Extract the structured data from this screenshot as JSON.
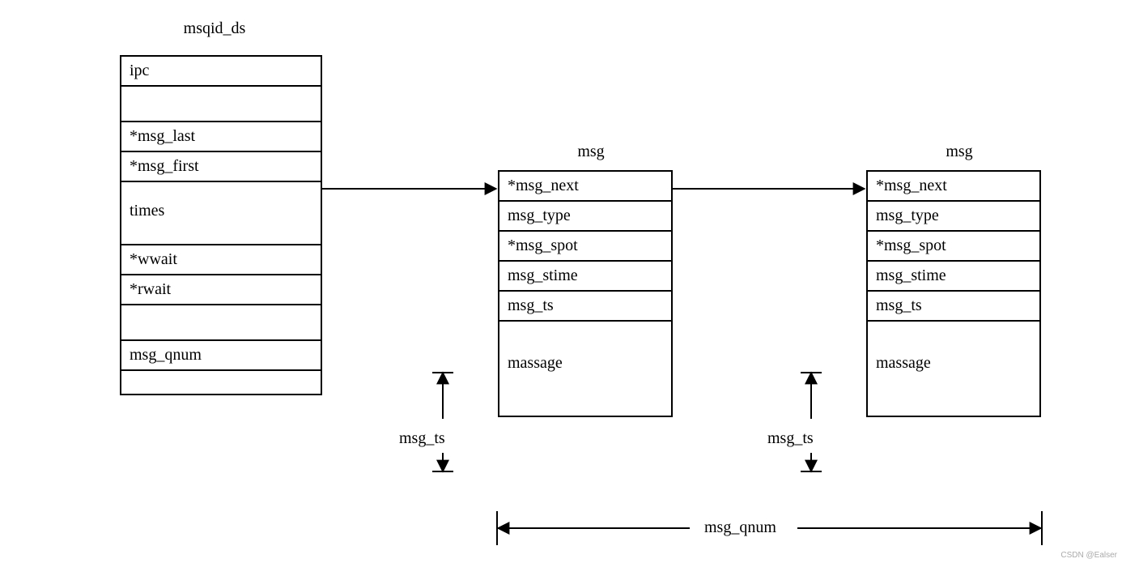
{
  "msqid_ds": {
    "title": "msqid_ds",
    "rows": [
      "ipc",
      "",
      "*msg_last",
      "*msg_first",
      "times",
      "*wwait",
      "*rwait",
      "",
      "msg_qnum",
      ""
    ]
  },
  "msg1": {
    "title": "msg",
    "rows": [
      "*msg_next",
      "msg_type",
      "*msg_spot",
      "msg_stime",
      "msg_ts",
      "massage"
    ]
  },
  "msg2": {
    "title": "msg",
    "rows": [
      "*msg_next",
      "msg_type",
      "*msg_spot",
      "msg_stime",
      "msg_ts",
      "massage"
    ]
  },
  "labels": {
    "msg_ts_1": "msg_ts",
    "msg_ts_2": "msg_ts",
    "msg_qnum": "msg_qnum"
  },
  "watermark": "CSDN @Ealser"
}
